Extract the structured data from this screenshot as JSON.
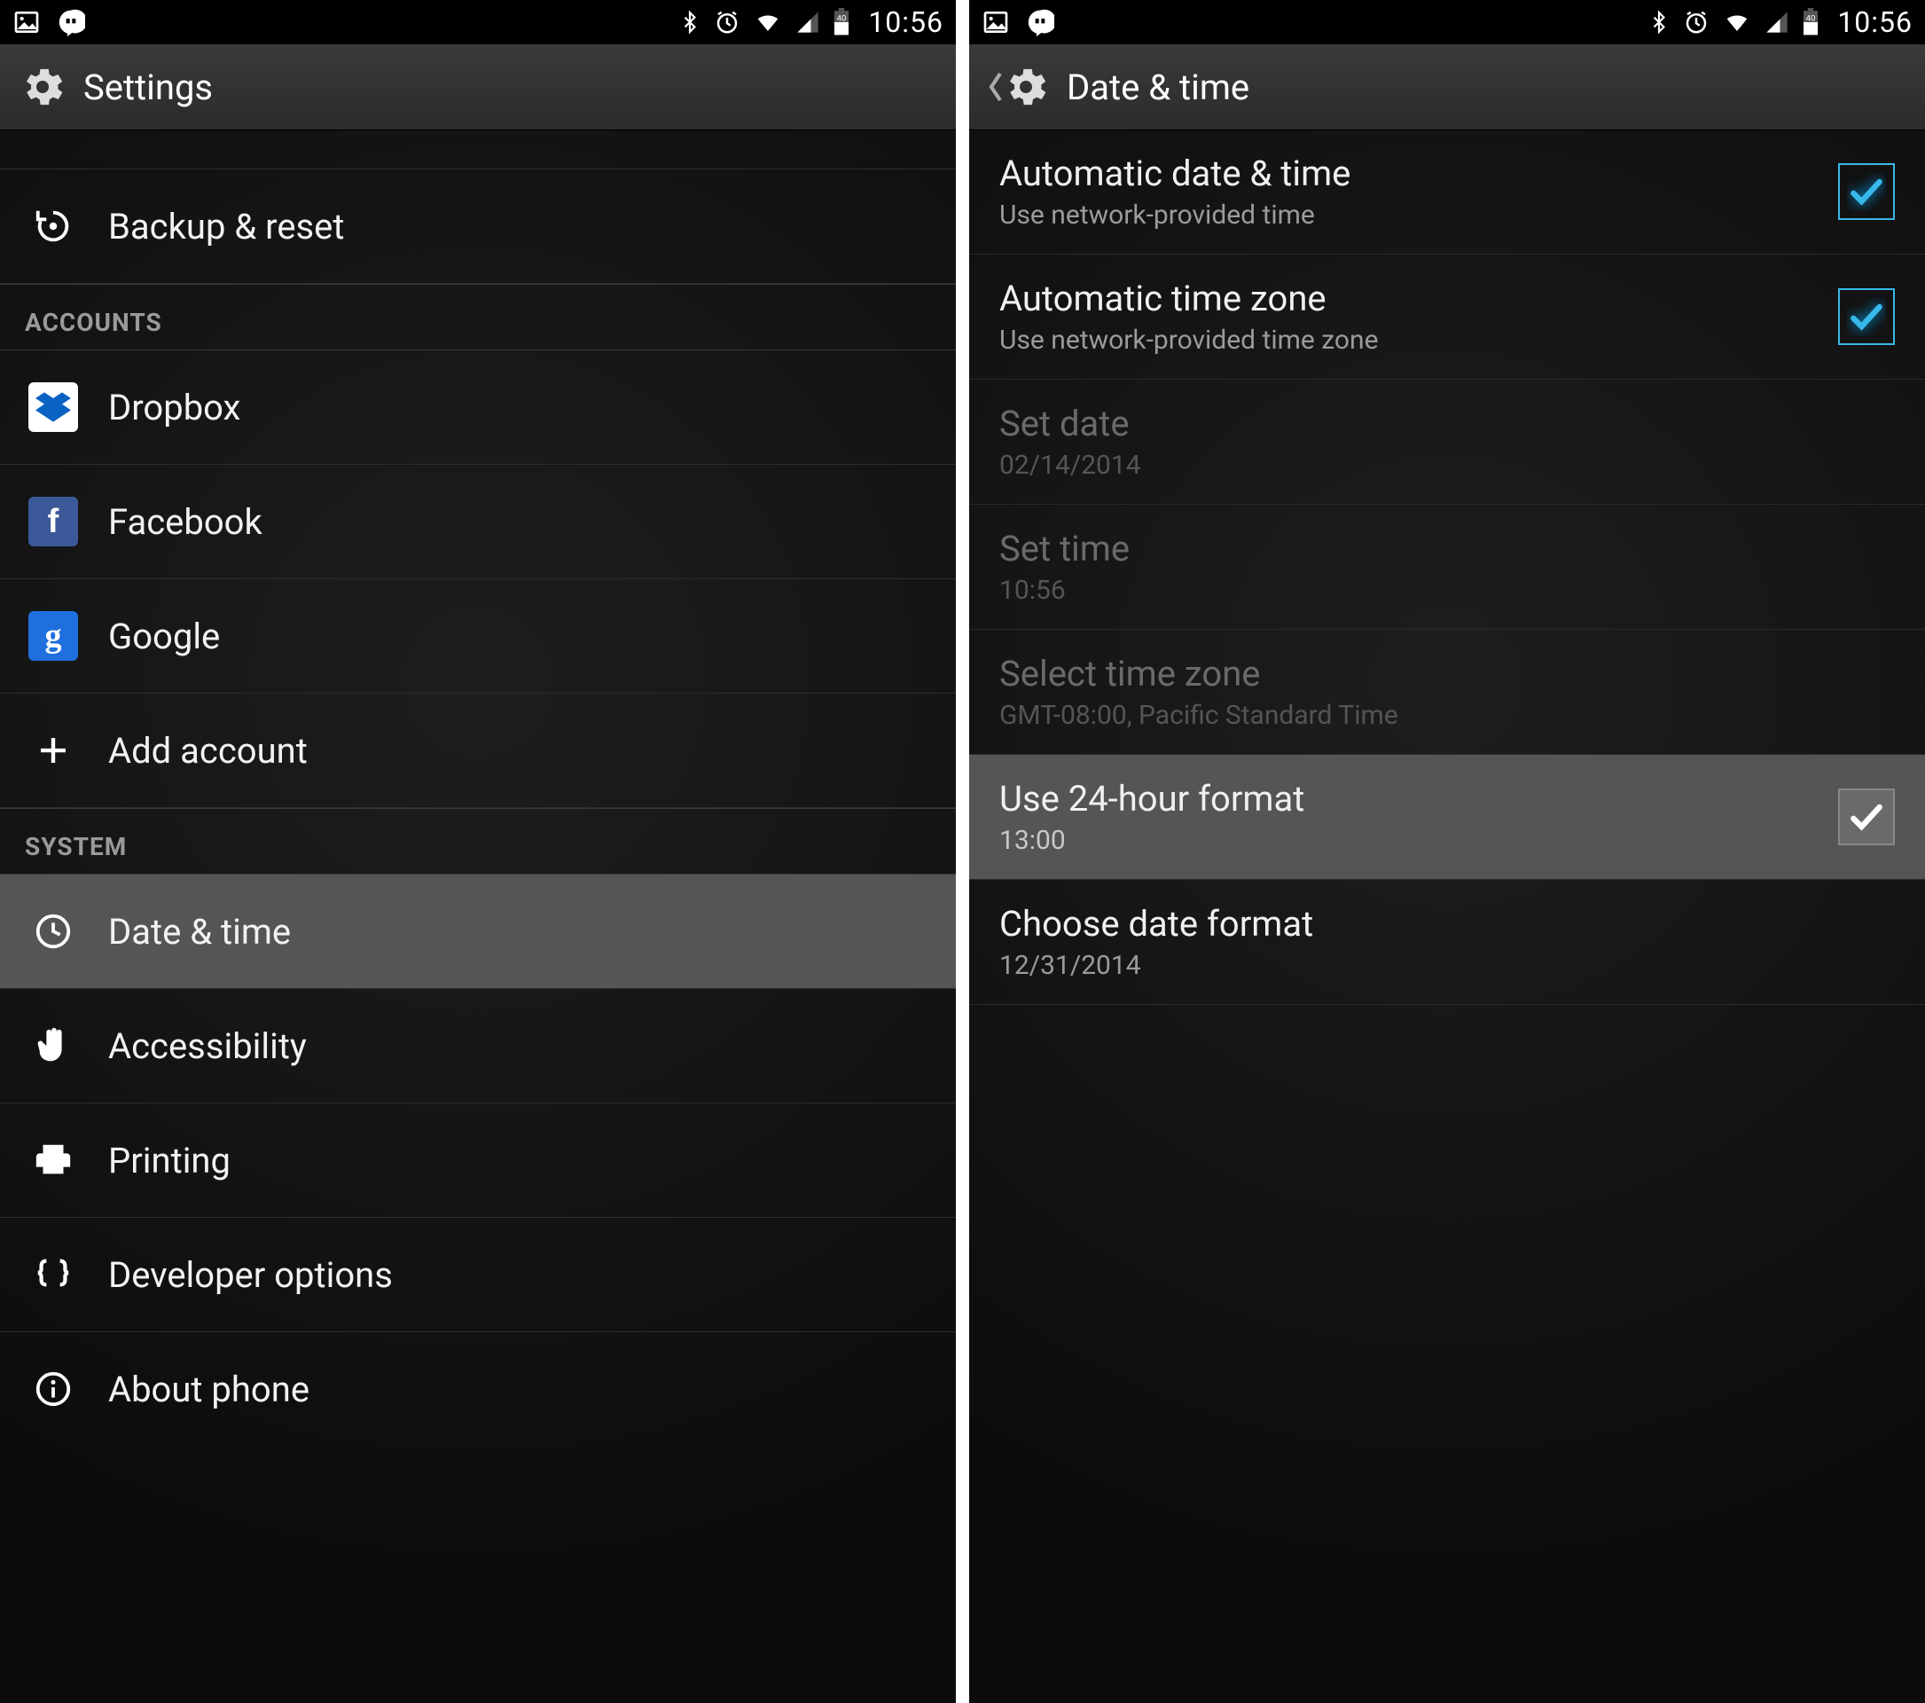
{
  "status": {
    "time": "10:56"
  },
  "left": {
    "title": "Settings",
    "rows": {
      "backup": "Backup & reset",
      "accounts_header": "ACCOUNTS",
      "dropbox": "Dropbox",
      "facebook": "Facebook",
      "google": "Google",
      "add_account": "Add account",
      "system_header": "SYSTEM",
      "date_time": "Date & time",
      "accessibility": "Accessibility",
      "printing": "Printing",
      "developer": "Developer options",
      "about": "About phone"
    }
  },
  "right": {
    "title": "Date & time",
    "auto_dt": {
      "label": "Automatic date & time",
      "sub": "Use network-provided time"
    },
    "auto_tz": {
      "label": "Automatic time zone",
      "sub": "Use network-provided time zone"
    },
    "set_date": {
      "label": "Set date",
      "sub": "02/14/2014"
    },
    "set_time": {
      "label": "Set time",
      "sub": "10:56"
    },
    "sel_tz": {
      "label": "Select time zone",
      "sub": "GMT-08:00, Pacific Standard Time"
    },
    "fmt24": {
      "label": "Use 24-hour format",
      "sub": "13:00"
    },
    "date_fmt": {
      "label": "Choose date format",
      "sub": "12/31/2014"
    }
  }
}
